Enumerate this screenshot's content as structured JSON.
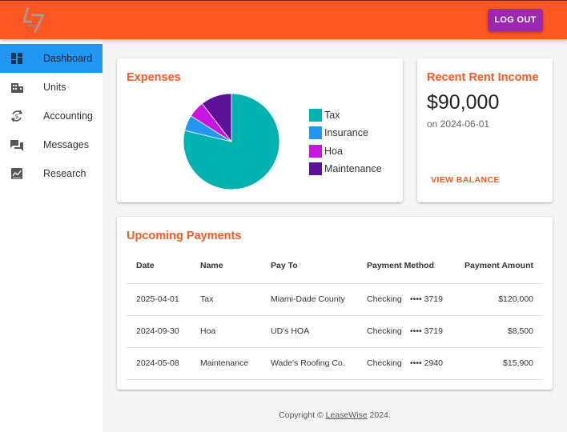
{
  "header": {
    "logout_label": "LOG OUT",
    "brand_color": "#ff5722",
    "logout_color": "#9c27b0"
  },
  "sidebar": {
    "items": [
      {
        "label": "Dashboard",
        "icon": "dashboard-icon",
        "active": true
      },
      {
        "label": "Units",
        "icon": "building-icon",
        "active": false
      },
      {
        "label": "Accounting",
        "icon": "currency-exchange-icon",
        "active": false
      },
      {
        "label": "Messages",
        "icon": "forum-icon",
        "active": false
      },
      {
        "label": "Research",
        "icon": "trending-chart-icon",
        "active": false
      }
    ],
    "active_color": "#2196f3"
  },
  "expenses": {
    "title": "Expenses",
    "legend": [
      {
        "label": "Tax",
        "color": "#00b3b0"
      },
      {
        "label": "Insurance",
        "color": "#2196f3"
      },
      {
        "label": "Hoa",
        "color": "#c815e0"
      },
      {
        "label": "Maintenance",
        "color": "#5d1198"
      }
    ]
  },
  "chart_data": {
    "type": "pie",
    "categories": [
      "Tax",
      "Insurance",
      "Hoa",
      "Maintenance"
    ],
    "values": [
      120000,
      8000,
      8500,
      15900
    ],
    "colors": [
      "#00b3b0",
      "#2196f3",
      "#c815e0",
      "#5d1198"
    ],
    "legend_position": "right"
  },
  "rent_income": {
    "title": "Recent Rent Income",
    "amount": "$90,000",
    "date": "on 2024-06-01",
    "action_label": "VIEW BALANCE"
  },
  "payments": {
    "title": "Upcoming Payments",
    "columns": [
      "Date",
      "Name",
      "Pay To",
      "Payment Method",
      "Payment Amount"
    ],
    "rows": [
      {
        "date": "2025-04-01",
        "name": "Tax",
        "pay_to": "Miami-Dade County",
        "method": "Checking",
        "last4": "•••• 3719",
        "amount": "$120,000"
      },
      {
        "date": "2024-09-30",
        "name": "Hoa",
        "pay_to": "UD's HOA",
        "method": "Checking",
        "last4": "•••• 3719",
        "amount": "$8,500"
      },
      {
        "date": "2024-05-08",
        "name": "Maintenance",
        "pay_to": "Wade's Roofing Co.",
        "method": "Checking",
        "last4": "•••• 2940",
        "amount": "$15,900"
      }
    ]
  },
  "footer": {
    "prefix": "Copyright © ",
    "link": "LeaseWise",
    "suffix": " 2024."
  }
}
